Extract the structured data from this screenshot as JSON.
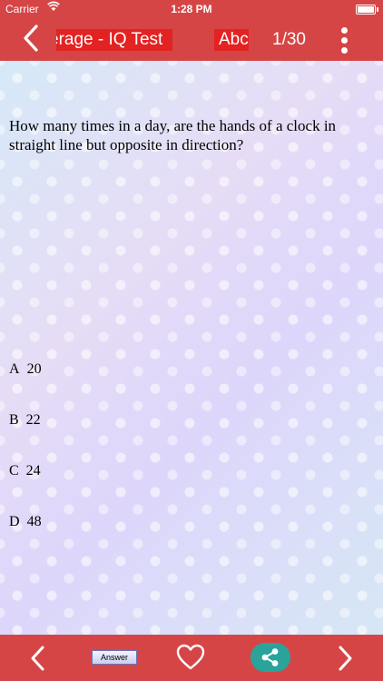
{
  "status_bar": {
    "carrier": "Carrier",
    "time": "1:28 PM",
    "icons": [
      "wifi-icon",
      "battery-icon"
    ]
  },
  "nav": {
    "title": "erage - IQ Test",
    "abc_label": "Abc",
    "counter": "1/30",
    "icons": [
      "back-chevron-icon",
      "kebab-menu-icon"
    ]
  },
  "question": {
    "text": "How many times in a day, are the hands of a clock in straight line but opposite in direction?"
  },
  "options": [
    {
      "letter": "A",
      "value": "20"
    },
    {
      "letter": "B",
      "value": "22"
    },
    {
      "letter": "C",
      "value": "24"
    },
    {
      "letter": "D",
      "value": "48"
    }
  ],
  "bottom_bar": {
    "answer_label": "Answer",
    "icons": [
      "prev-chevron-icon",
      "heart-icon",
      "share-icon",
      "next-chevron-icon"
    ]
  },
  "colors": {
    "bar_red": "#d64545",
    "title_highlight": "#e32222",
    "share_teal": "#2aa39a"
  }
}
